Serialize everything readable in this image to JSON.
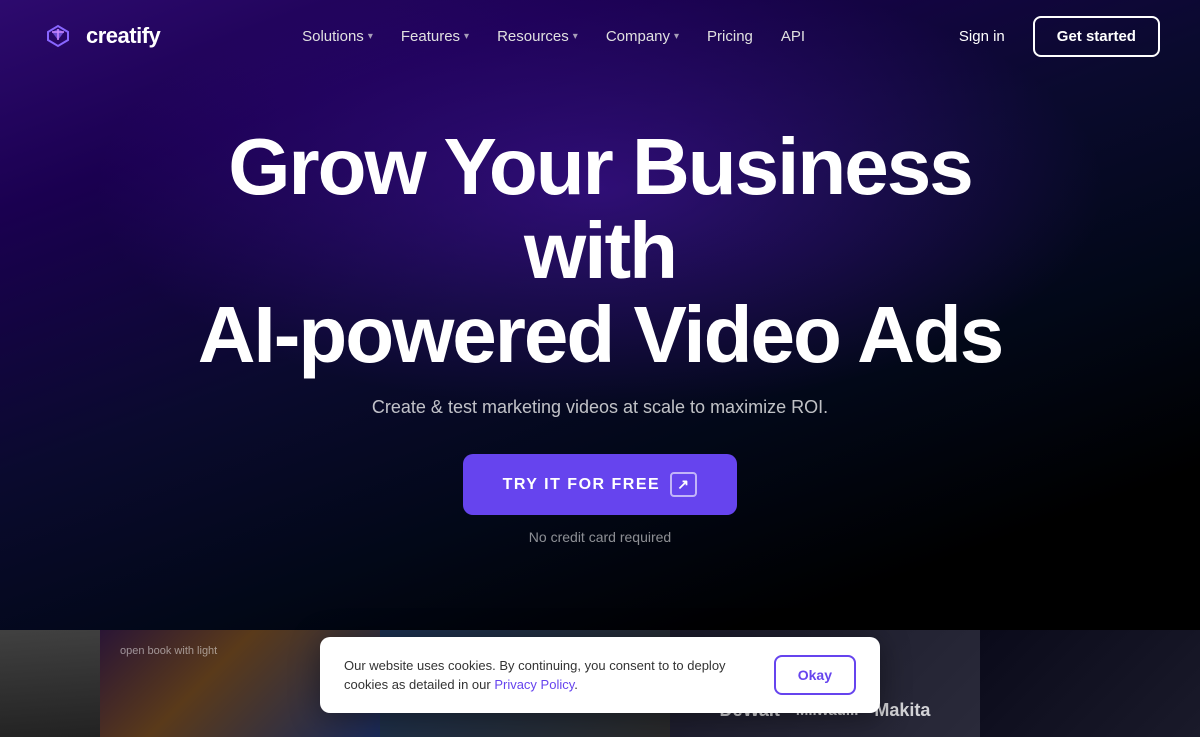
{
  "logo": {
    "text": "creatify",
    "icon_name": "creatify-logo-icon"
  },
  "navbar": {
    "links": [
      {
        "label": "Solutions",
        "has_dropdown": true
      },
      {
        "label": "Features",
        "has_dropdown": true
      },
      {
        "label": "Resources",
        "has_dropdown": true
      },
      {
        "label": "Company",
        "has_dropdown": true
      },
      {
        "label": "Pricing",
        "has_dropdown": false
      },
      {
        "label": "API",
        "has_dropdown": false
      }
    ],
    "sign_in": "Sign in",
    "get_started": "Get started"
  },
  "hero": {
    "title_line1": "Grow Your Business with",
    "title_line2": "AI-powered Video Ads",
    "subtitle": "Create & test marketing videos at scale to maximize ROI.",
    "cta_label": "TRY IT FOR FREE",
    "cta_arrow": "↗",
    "no_card_text": "No credit card required"
  },
  "thumbnails": {
    "brands": [
      "DeWalt",
      "Milwau...",
      "Makita"
    ]
  },
  "cookie": {
    "message": "Our website uses cookies. By continuing, you consent to to deploy cookies as detailed in our Privacy Policy.",
    "privacy_link": "Privacy Policy",
    "okay_label": "Okay"
  },
  "colors": {
    "accent": "#6644ee",
    "bg_dark": "#000010",
    "hero_purple": "#2d0a6e"
  }
}
